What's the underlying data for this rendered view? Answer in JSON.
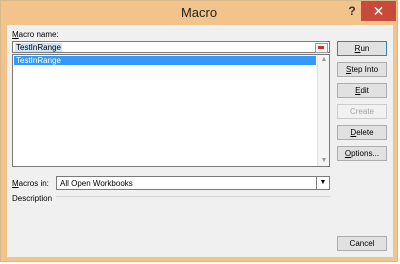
{
  "window": {
    "title": "Macro",
    "help_glyph": "?",
    "close_glyph": "✕"
  },
  "macro_name": {
    "label_prefix": "M",
    "label_rest": "acro name:",
    "value": "TestInRange"
  },
  "macro_list": {
    "items": [
      "TestInRange"
    ],
    "selected_index": 0
  },
  "macros_in": {
    "label_prefix": "M",
    "label_rest": "acros in:",
    "value": "All Open Workbooks"
  },
  "description": {
    "label": "Description"
  },
  "buttons": {
    "run": {
      "prefix": "R",
      "rest": "un"
    },
    "step_into": {
      "prefix": "S",
      "rest": "tep Into"
    },
    "edit": {
      "prefix": "E",
      "rest": "dit"
    },
    "create": {
      "prefix": "",
      "rest": "Create"
    },
    "delete": {
      "prefix": "D",
      "rest": "elete"
    },
    "options": {
      "prefix": "O",
      "rest": "ptions..."
    },
    "cancel": {
      "prefix": "",
      "rest": "Cancel"
    }
  },
  "icons": {
    "macro_picker": "range-picker-icon",
    "scroll_up": "arrow-up-icon",
    "scroll_down": "arrow-down-icon",
    "dropdown": "chevron-down-icon"
  },
  "colors": {
    "titlebar": "#f2c48b",
    "close": "#c84a3a",
    "selection": "#3399ff"
  }
}
